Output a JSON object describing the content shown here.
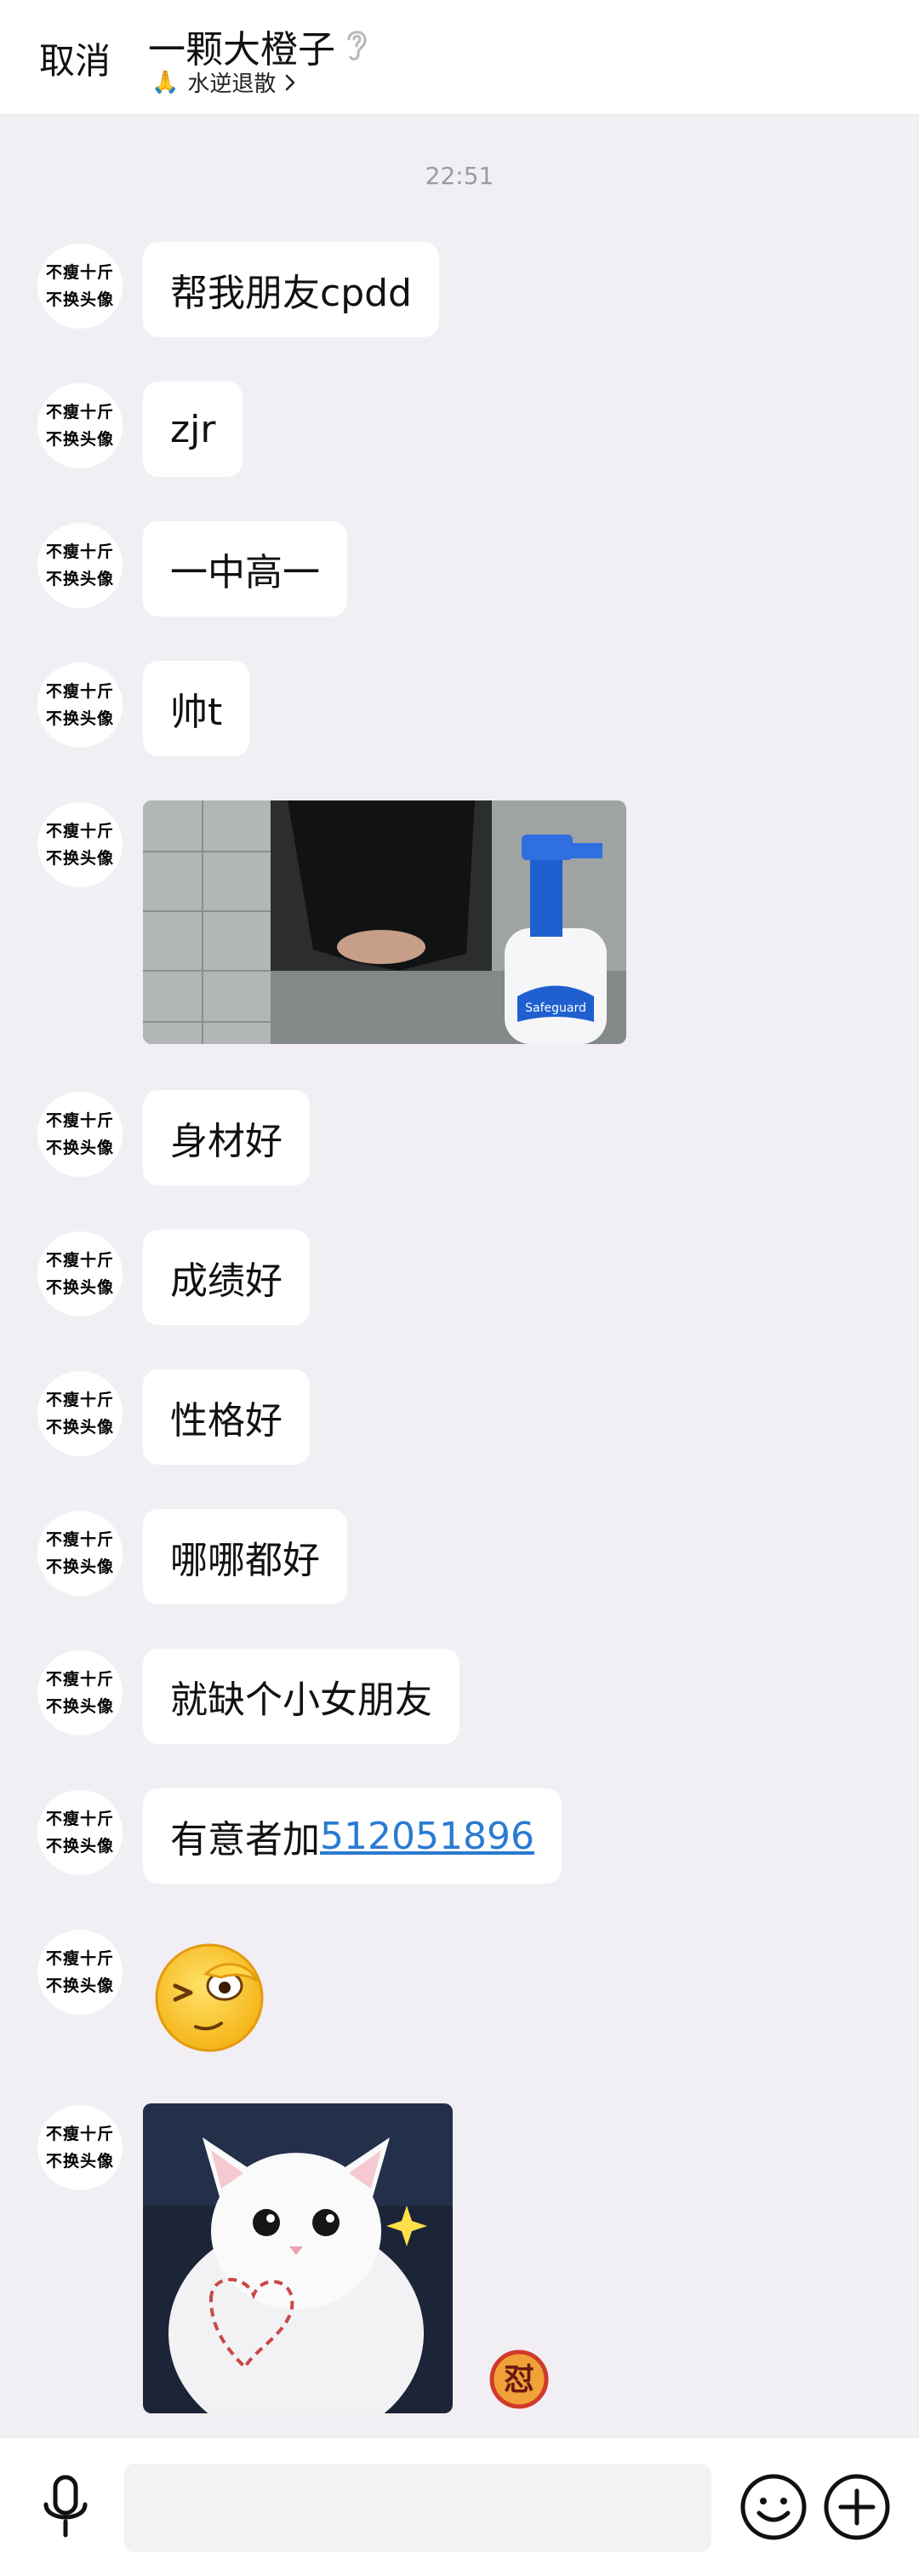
{
  "header": {
    "cancel_label": "取消",
    "title": "一颗大橙子",
    "subtitle": "水逆退散",
    "subtitle_emoji": "🙏"
  },
  "timestamp": "22:51",
  "avatar": {
    "line1": "不瘦十斤",
    "line2": "不换头像"
  },
  "messages": {
    "m1": "帮我朋友cpdd",
    "m2": "zjr",
    "m3": "一中高一",
    "m4": "帅t",
    "m5": "身材好",
    "m6": "成绩好",
    "m7": "性格好",
    "m8": "哪哪都好",
    "m9": "就缺个小女朋友",
    "m10_prefix": "有意者加",
    "m10_link": "512051896"
  },
  "photo_product_text": "Safeguard",
  "badge_text": "怼",
  "input": {
    "placeholder": ""
  },
  "colors": {
    "background": "#f1eff3",
    "bubble": "#ffffff",
    "link": "#2a7bd2",
    "timestamp": "#9a9a9f"
  }
}
